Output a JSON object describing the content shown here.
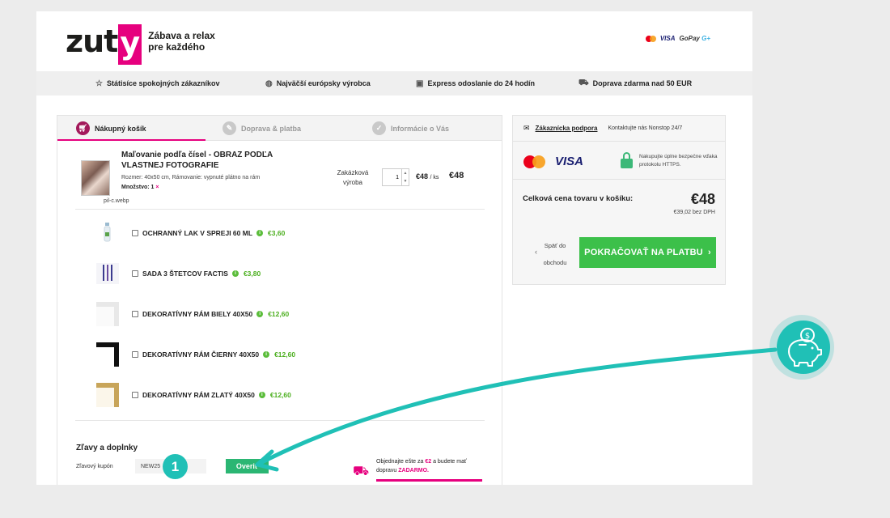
{
  "brand": {
    "logo_text": "zuty",
    "tagline_line1": "Zábava a relax",
    "tagline_line2": "pre každého",
    "pink": "#e6007e"
  },
  "header_payments": {
    "visa": "VISA",
    "gopay": "GoPay",
    "gopay_mark": "G+"
  },
  "benefits": [
    {
      "icon": "star-icon",
      "label": "Státisíce spokojných zákazníkov"
    },
    {
      "icon": "globe-icon",
      "label": "Najväčší európsky výrobca"
    },
    {
      "icon": "package-icon",
      "label": "Express odoslanie do 24 hodín"
    },
    {
      "icon": "truck-icon",
      "label": "Doprava zdarma nad 50 EUR"
    }
  ],
  "steps": [
    {
      "label": "Nákupný košík",
      "active": true
    },
    {
      "label": "Doprava & platba",
      "active": false
    },
    {
      "label": "Informácie o Vás",
      "active": false
    }
  ],
  "product": {
    "title": "Maľovanie podľa čísel - OBRAZ PODĽA VLASTNEJ FOTOGRAFIE",
    "size_line": "Rozmer: 40x50 cm, Rámovanie: vypnuté plátno na rám",
    "qty_label": "Množstvo: 1",
    "remove": "×",
    "image_caption": "pil-c.webp",
    "qty_word": "Zakázková výroba",
    "qty_value": "1",
    "unit_price": "€48",
    "unit_suffix": "/ ks",
    "total": "€48"
  },
  "addons": [
    {
      "name": "OCHRANNÝ LAK V SPREJI 60 ML",
      "price": "€3,60"
    },
    {
      "name": "SADA 3 ŠTETCOV FACTIS",
      "price": "€3,80"
    },
    {
      "name": "DEKORATÍVNY RÁM BIELY 40X50",
      "price": "€12,60"
    },
    {
      "name": "DEKORATÍVNY RÁM ČIERNY 40X50",
      "price": "€12,60"
    },
    {
      "name": "DEKORATÍVNY RÁM ZLATÝ 40X50",
      "price": "€12,60"
    }
  ],
  "discounts": {
    "title": "Zľavy a doplnky",
    "coupon_label": "Zľavový kupón",
    "coupon_value": "NEW25",
    "verify_label": "Overiť"
  },
  "delivery": {
    "line1_pre": "Objednajte ešte za",
    "amount": "€2",
    "line1_post": "a budete mať",
    "line2_pre": "dopravu",
    "free": "ZADARMO.",
    "progress_percent": 96
  },
  "sidebar": {
    "support_link": "Zákaznícka podpora",
    "support_note": "Kontaktujte nás Nonstop 24/7",
    "visa": "VISA",
    "secure_text": "Nakupujte úplne bezpečne vďaka protokolu HTTPS.",
    "total_label": "Celková cena tovaru v košíku:",
    "total_amount": "€48",
    "total_vat": "€39,02 bez DPH",
    "back_label": "Späť do obchodu",
    "pay_label": "POKRAČOVAŤ NA PLATBU",
    "pay_color": "#3cc04a"
  },
  "annotation": {
    "step_number": "1",
    "accent": "#20c0b6",
    "icon": "piggy-bank-icon"
  }
}
